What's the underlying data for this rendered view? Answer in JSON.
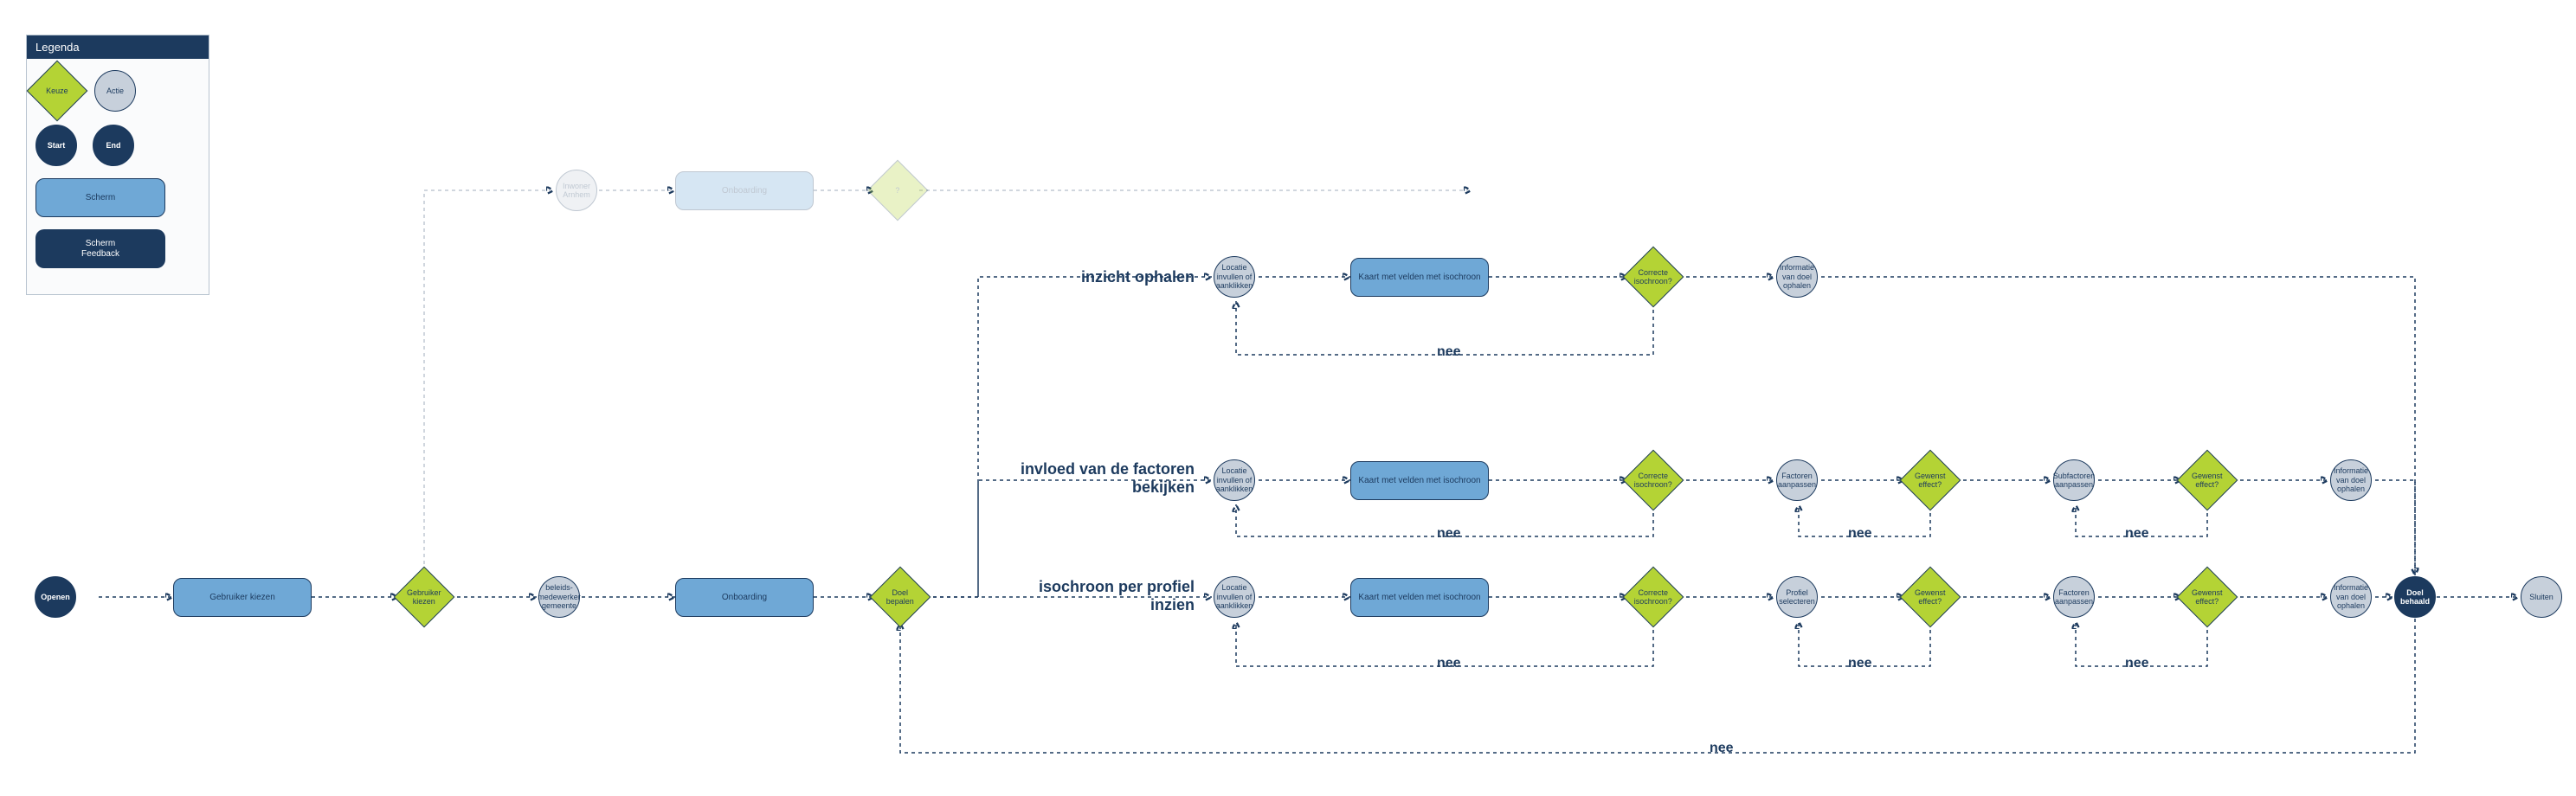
{
  "legend": {
    "title": "Legenda",
    "keuze": "Keuze",
    "actie": "Actie",
    "start": "Start",
    "end": "End",
    "scherm": "Scherm",
    "scherm_feedback": "Scherm\nFeedback"
  },
  "main": {
    "openen": "Openen",
    "gebruiker_kiezen": "Gebruiker kiezen",
    "gebruiker_kiezen_d": "Gebruiker kiezen",
    "beleids": "beleids-medewerker gemeente",
    "onboarding": "Onboarding",
    "doel_bepalen": "Doel bepalen",
    "doel_behaald": "Doel behaald",
    "sluiten": "Sluiten"
  },
  "faded": {
    "inwoner": "Inwoner Arnhem",
    "onboarding": "Onboarding",
    "q": "?"
  },
  "rows": {
    "r1": {
      "label": "inzicht ophalen",
      "loc": "Locatie invullen of aanklikken",
      "kaart": "Kaart met velden met isochroon",
      "correcte": "Correcte isochroon?",
      "info": "Informatie van doel ophalen"
    },
    "r2": {
      "label": "invloed van de factoren bekijken",
      "loc": "Locatie invullen of aanklikken",
      "kaart": "Kaart met velden met isochroon",
      "correcte": "Correcte isochroon?",
      "factoren": "Factoren aanpassen",
      "gewenst1": "Gewenst effect?",
      "sub": "Subfactoren aanpassen",
      "gewenst2": "Gewenst effect?",
      "info": "Informatie van doel ophalen"
    },
    "r3": {
      "label": "isochroon per profiel inzien",
      "loc": "Locatie invullen of aanklikken",
      "kaart": "Kaart met velden met isochroon",
      "correcte": "Correcte isochroon?",
      "profiel": "Profiel selecteren",
      "gewenst1": "Gewenst effect?",
      "factoren": "Factoren aanpassen",
      "gewenst2": "Gewenst effect?",
      "info": "Informatie van doel ophalen"
    }
  },
  "labels": {
    "nee": "nee"
  }
}
